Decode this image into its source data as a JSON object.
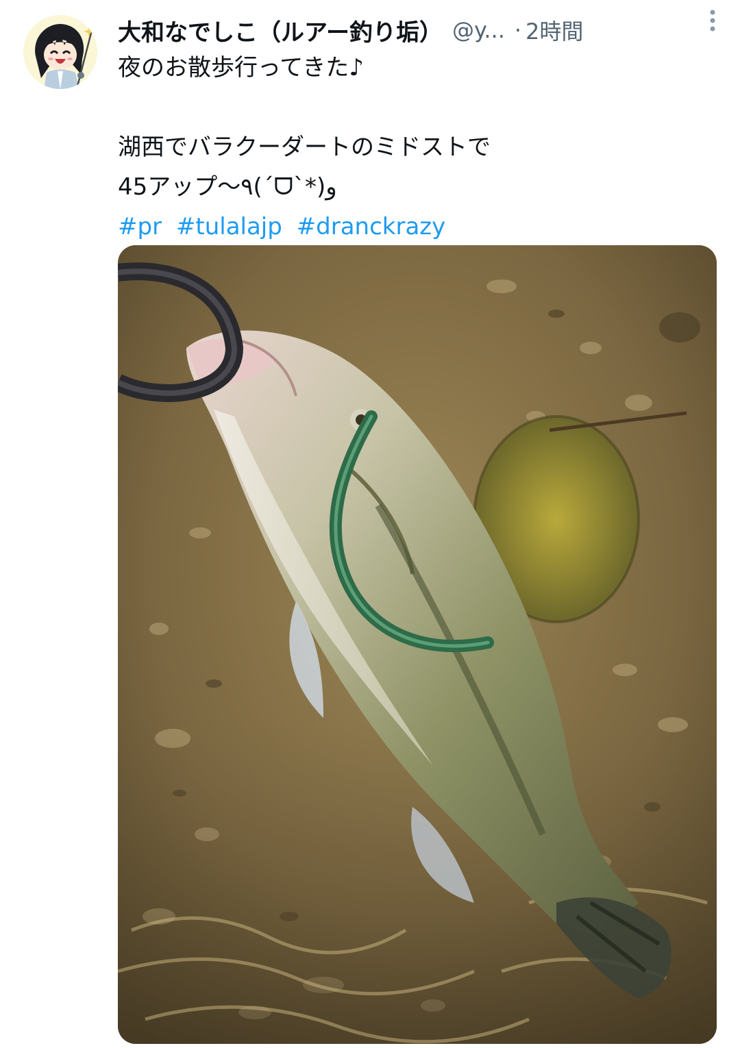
{
  "tweet": {
    "display_name": "大和なでしこ（ルアー釣り垢）",
    "handle": "@y...",
    "separator": "·",
    "time": "2時間",
    "text_lines": [
      "夜のお散歩行ってきた♪",
      "",
      "湖西でバラクーダートのミドストで",
      "45アップ〜٩(´ᗜ`*)و"
    ],
    "hashtags": [
      "#pr",
      "#tulalajp",
      "#dranckrazy"
    ],
    "colors": {
      "text": "#0f1419",
      "secondary": "#536471",
      "link": "#1d9bf0"
    },
    "icons": {
      "avatar": "anime-girl-avatar",
      "more": "more-vertical-icon"
    }
  }
}
